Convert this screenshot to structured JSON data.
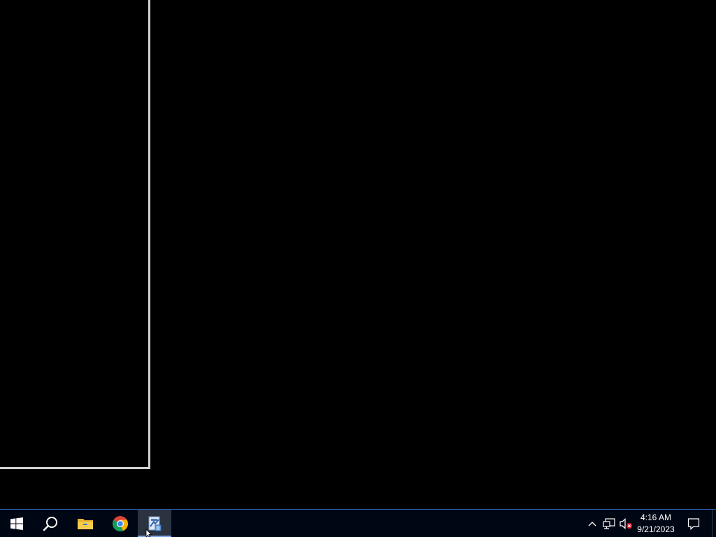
{
  "desktop": {
    "window_outline": "empty-window-frame"
  },
  "taskbar": {
    "start_icon": "windows-logo-icon",
    "search_icon": "search-icon",
    "pinned_apps": [
      {
        "icon": "file-explorer-icon"
      },
      {
        "icon": "chrome-icon"
      },
      {
        "icon": "installer-app-icon",
        "active": true
      }
    ],
    "tray": {
      "chevron_icon": "chevron-up-icon",
      "network_icon": "network-icon",
      "volume_icon": "volume-muted-icon"
    },
    "clock": {
      "time": "4:16 AM",
      "date": "9/21/2023"
    },
    "notification_icon": "action-center-icon"
  },
  "colors": {
    "taskbar_bg": "#000714",
    "taskbar_border": "#2a5aa8",
    "active_app_bg": "#2b3340",
    "active_indicator": "#7aa7e6",
    "window_border": "#d2d2d2"
  }
}
